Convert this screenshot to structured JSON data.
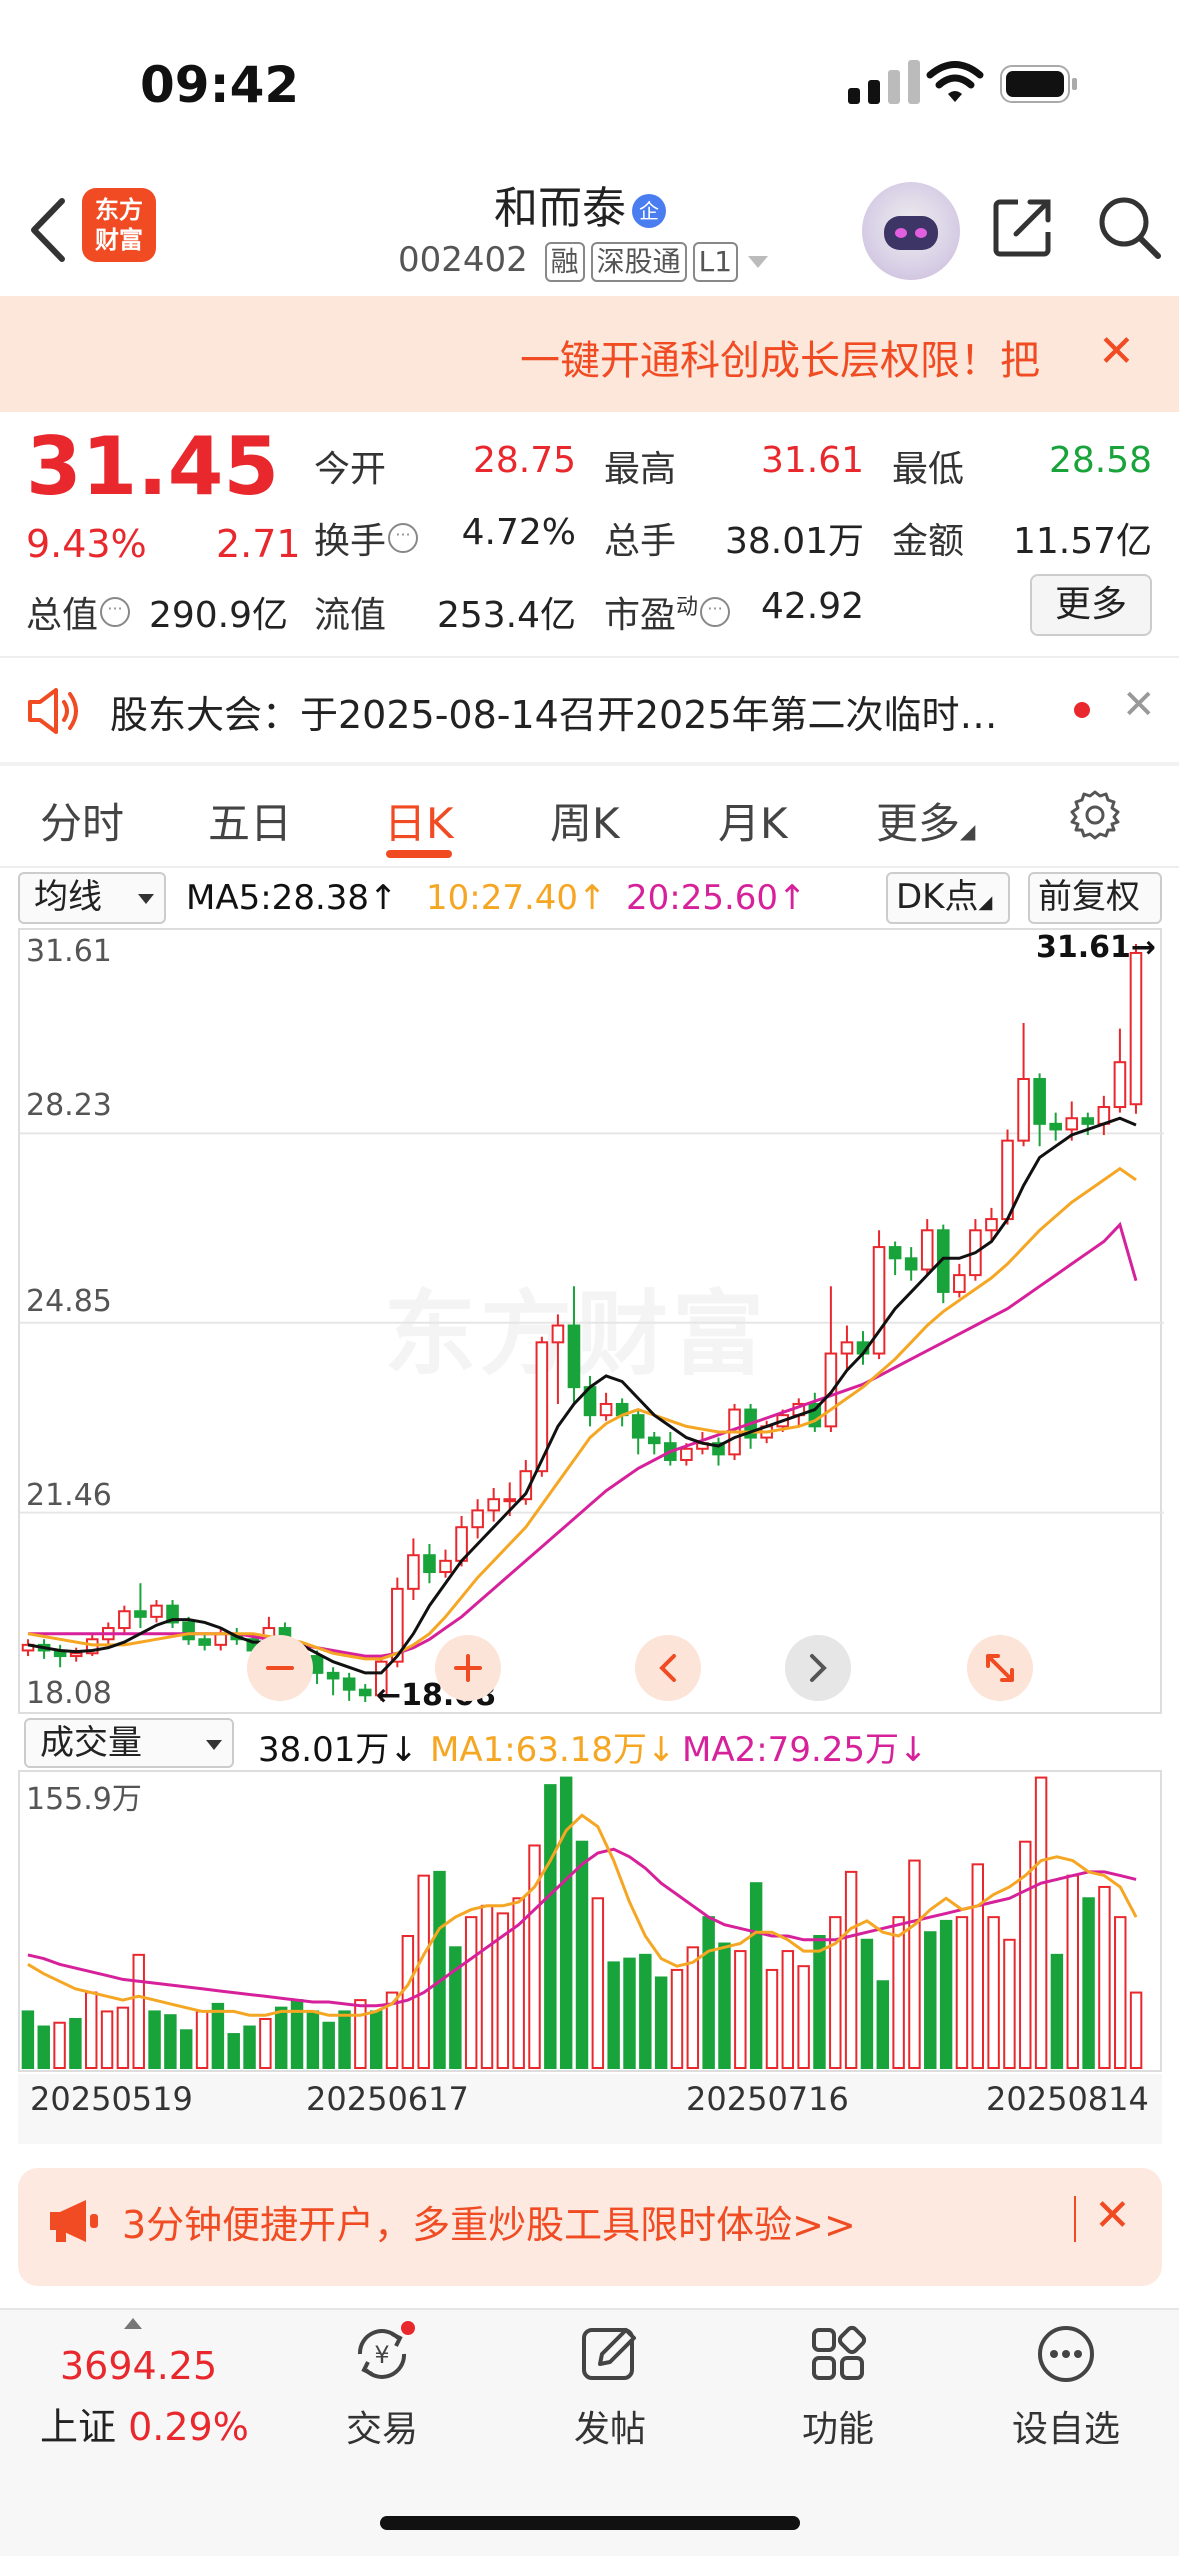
{
  "status_bar": {
    "time": "09:42"
  },
  "header": {
    "logo_text_1": "东方",
    "logo_text_2": "财富",
    "title": "和而泰",
    "badge": "企",
    "code": "002402",
    "tags": [
      "融",
      "深股通",
      "L1"
    ]
  },
  "banner": {
    "text": "一键开通科创成长层权限！把",
    "close": "✕"
  },
  "quote": {
    "price": "31.45",
    "change_pct": "9.43%",
    "change_amt": "2.71",
    "stats": [
      {
        "label": "今开",
        "value": "28.75",
        "color": "#e8282d"
      },
      {
        "label": "最高",
        "value": "31.61",
        "color": "#e8282d"
      },
      {
        "label": "最低",
        "value": "28.58",
        "color": "#19a33b"
      },
      {
        "label": "换手",
        "value": "4.72%",
        "color": "#222222"
      },
      {
        "label": "总手",
        "value": "38.01万",
        "color": "#222222"
      },
      {
        "label": "金额",
        "value": "11.57亿",
        "color": "#222222"
      },
      {
        "label": "总值",
        "value": "290.9亿",
        "color": "#222222"
      },
      {
        "label": "流值",
        "value": "253.4亿",
        "color": "#222222"
      },
      {
        "label": "市盈",
        "value": "42.92",
        "color": "#222222"
      }
    ],
    "pe_sup": "动",
    "more": "更多"
  },
  "notice": {
    "text": "股东大会：于2025-08-14召开2025年第二次临时…",
    "close": "✕"
  },
  "tabs": [
    "分时",
    "五日",
    "日K",
    "周K",
    "月K",
    "更多"
  ],
  "active_tab": "日K",
  "ma_bar": {
    "select": "均线",
    "ma5": "MA5:28.38↑",
    "ma10": "10:27.40↑",
    "ma20": "20:25.60↑",
    "dk": "DK点",
    "adjust": "前复权"
  },
  "vol_bar": {
    "select": "成交量",
    "vol": "38.01万↓",
    "ma1": "MA1:63.18万↓",
    "ma2": "MA2:79.25万↓"
  },
  "colors": {
    "up": "#e8282d",
    "down": "#19a33b",
    "ma5": "#111111",
    "ma10": "#f5a623",
    "ma20": "#d6219b",
    "brand": "#f04b23"
  },
  "watermark": "东方财富",
  "chart_data": [
    {
      "type": "candlestick",
      "title": "",
      "y_axis_labels": [
        "31.61",
        "28.23",
        "24.85",
        "21.46",
        "18.08"
      ],
      "ylim": [
        18.08,
        31.61
      ],
      "high_marker": "31.61→",
      "low_marker": "←18.08",
      "x_labels": [
        "20250519",
        "20250617",
        "20250716",
        "20250814"
      ],
      "candles": [
        [
          19.0,
          19.1,
          18.9,
          19.2
        ],
        [
          19.1,
          19.0,
          18.85,
          19.2
        ],
        [
          19.0,
          18.9,
          18.7,
          19.1
        ],
        [
          18.9,
          18.95,
          18.8,
          19.05
        ],
        [
          18.95,
          19.2,
          18.9,
          19.3
        ],
        [
          19.2,
          19.4,
          19.1,
          19.5
        ],
        [
          19.4,
          19.7,
          19.3,
          19.8
        ],
        [
          19.7,
          19.6,
          19.4,
          20.2
        ],
        [
          19.6,
          19.8,
          19.5,
          19.9
        ],
        [
          19.8,
          19.5,
          19.4,
          19.9
        ],
        [
          19.5,
          19.2,
          19.1,
          19.6
        ],
        [
          19.2,
          19.1,
          19.0,
          19.3
        ],
        [
          19.1,
          19.3,
          19.0,
          19.4
        ],
        [
          19.3,
          19.2,
          19.1,
          19.4
        ],
        [
          19.2,
          19.0,
          18.9,
          19.3
        ],
        [
          19.0,
          19.4,
          18.9,
          19.6
        ],
        [
          19.4,
          19.0,
          18.8,
          19.5
        ],
        [
          19.0,
          18.9,
          18.7,
          19.1
        ],
        [
          18.9,
          18.6,
          18.4,
          19.0
        ],
        [
          18.6,
          18.5,
          18.2,
          18.7
        ],
        [
          18.5,
          18.3,
          18.1,
          18.6
        ],
        [
          18.3,
          18.2,
          18.08,
          18.4
        ],
        [
          18.2,
          18.8,
          18.1,
          18.9
        ],
        [
          18.8,
          20.1,
          18.7,
          20.3
        ],
        [
          20.1,
          20.7,
          19.9,
          21.0
        ],
        [
          20.7,
          20.4,
          20.2,
          20.9
        ],
        [
          20.4,
          20.6,
          20.3,
          20.8
        ],
        [
          20.6,
          21.2,
          20.5,
          21.4
        ],
        [
          21.2,
          21.5,
          21.0,
          21.7
        ],
        [
          21.5,
          21.7,
          21.3,
          21.9
        ],
        [
          21.7,
          21.7,
          21.4,
          22.0
        ],
        [
          21.7,
          22.2,
          21.6,
          22.4
        ],
        [
          22.2,
          24.5,
          22.1,
          24.6
        ],
        [
          24.5,
          24.8,
          23.4,
          25.0
        ],
        [
          24.8,
          23.7,
          23.4,
          25.5
        ],
        [
          23.7,
          23.2,
          23.0,
          23.9
        ],
        [
          23.2,
          23.4,
          23.1,
          23.6
        ],
        [
          23.4,
          23.2,
          23.0,
          23.5
        ],
        [
          23.2,
          22.8,
          22.5,
          23.3
        ],
        [
          22.8,
          22.7,
          22.5,
          22.9
        ],
        [
          22.7,
          22.4,
          22.3,
          22.9
        ],
        [
          22.4,
          22.6,
          22.3,
          22.7
        ],
        [
          22.6,
          22.7,
          22.5,
          22.9
        ],
        [
          22.7,
          22.5,
          22.3,
          22.8
        ],
        [
          22.5,
          23.3,
          22.4,
          23.4
        ],
        [
          23.3,
          22.8,
          22.6,
          23.4
        ],
        [
          22.8,
          23.0,
          22.7,
          23.1
        ],
        [
          23.0,
          23.2,
          22.9,
          23.3
        ],
        [
          23.2,
          23.4,
          23.0,
          23.5
        ],
        [
          23.4,
          23.0,
          22.9,
          23.6
        ],
        [
          23.0,
          24.3,
          22.9,
          25.5
        ],
        [
          24.3,
          24.5,
          24.0,
          24.8
        ],
        [
          24.5,
          24.3,
          24.1,
          24.7
        ],
        [
          24.3,
          26.2,
          24.2,
          26.5
        ],
        [
          26.2,
          26.0,
          25.7,
          26.3
        ],
        [
          26.0,
          25.8,
          25.6,
          26.2
        ],
        [
          25.8,
          26.5,
          25.7,
          26.7
        ],
        [
          26.5,
          25.4,
          25.2,
          26.6
        ],
        [
          25.4,
          25.7,
          25.3,
          25.9
        ],
        [
          25.7,
          26.5,
          25.6,
          26.7
        ],
        [
          26.5,
          26.7,
          26.3,
          26.9
        ],
        [
          26.7,
          28.1,
          26.6,
          28.3
        ],
        [
          28.1,
          29.2,
          28.0,
          30.2
        ],
        [
          29.2,
          28.4,
          28.0,
          29.3
        ],
        [
          28.4,
          28.3,
          28.1,
          28.6
        ],
        [
          28.3,
          28.5,
          28.1,
          28.8
        ],
        [
          28.5,
          28.4,
          28.2,
          28.6
        ],
        [
          28.4,
          28.7,
          28.2,
          28.9
        ],
        [
          28.7,
          29.5,
          28.6,
          30.1
        ],
        [
          28.75,
          31.45,
          28.58,
          31.61
        ]
      ],
      "ma5": [
        19.1,
        19.05,
        19.0,
        18.98,
        19.0,
        19.05,
        19.15,
        19.3,
        19.45,
        19.55,
        19.55,
        19.5,
        19.4,
        19.25,
        19.15,
        19.15,
        19.15,
        19.1,
        18.95,
        18.8,
        18.7,
        18.6,
        18.6,
        18.9,
        19.3,
        19.8,
        20.2,
        20.6,
        20.9,
        21.2,
        21.5,
        21.8,
        22.4,
        23.0,
        23.4,
        23.7,
        23.9,
        23.8,
        23.5,
        23.2,
        23.0,
        22.8,
        22.7,
        22.65,
        22.8,
        22.9,
        23.0,
        23.1,
        23.2,
        23.3,
        23.6,
        24.0,
        24.3,
        24.7,
        25.1,
        25.4,
        25.7,
        26.0,
        26.0,
        26.1,
        26.3,
        26.7,
        27.3,
        27.8,
        28.0,
        28.2,
        28.3,
        28.4,
        28.5,
        28.38
      ],
      "ma10": [
        19.3,
        19.25,
        19.2,
        19.15,
        19.1,
        19.1,
        19.1,
        19.15,
        19.2,
        19.25,
        19.3,
        19.3,
        19.3,
        19.3,
        19.3,
        19.25,
        19.2,
        19.15,
        19.05,
        18.95,
        18.9,
        18.85,
        18.85,
        18.95,
        19.1,
        19.3,
        19.6,
        19.95,
        20.3,
        20.6,
        20.9,
        21.2,
        21.6,
        22.0,
        22.4,
        22.8,
        23.05,
        23.2,
        23.3,
        23.2,
        23.1,
        23.0,
        22.95,
        22.9,
        22.9,
        22.9,
        22.9,
        22.95,
        23.0,
        23.1,
        23.3,
        23.5,
        23.7,
        23.95,
        24.2,
        24.5,
        24.8,
        25.05,
        25.25,
        25.45,
        25.65,
        25.9,
        26.2,
        26.5,
        26.75,
        27.0,
        27.2,
        27.4,
        27.6,
        27.4
      ],
      "ma20": [
        19.3,
        19.3,
        19.3,
        19.3,
        19.3,
        19.3,
        19.3,
        19.3,
        19.3,
        19.3,
        19.3,
        19.3,
        19.3,
        19.3,
        19.25,
        19.2,
        19.15,
        19.1,
        19.05,
        19.0,
        18.95,
        18.9,
        18.9,
        18.95,
        19.05,
        19.2,
        19.4,
        19.6,
        19.85,
        20.1,
        20.35,
        20.6,
        20.85,
        21.1,
        21.35,
        21.6,
        21.85,
        22.05,
        22.25,
        22.4,
        22.55,
        22.65,
        22.75,
        22.85,
        22.95,
        23.05,
        23.15,
        23.25,
        23.35,
        23.45,
        23.55,
        23.65,
        23.75,
        23.9,
        24.05,
        24.2,
        24.35,
        24.5,
        24.65,
        24.8,
        24.95,
        25.1,
        25.3,
        25.5,
        25.7,
        25.9,
        26.1,
        26.3,
        26.6,
        25.6
      ]
    },
    {
      "type": "bar",
      "title": "",
      "y_axis_labels": [
        "155.9万"
      ],
      "ylim": [
        0,
        155.9
      ],
      "x_labels": [
        "20250519",
        "20250617",
        "20250716",
        "20250814"
      ],
      "values": [
        30,
        22,
        24,
        26,
        40,
        30,
        32,
        60,
        30,
        28,
        20,
        30,
        34,
        18,
        22,
        26,
        32,
        36,
        30,
        24,
        30,
        36,
        30,
        40,
        70,
        102,
        104,
        64,
        80,
        86,
        82,
        90,
        118,
        150,
        154,
        120,
        90,
        56,
        58,
        60,
        48,
        52,
        64,
        80,
        66,
        62,
        98,
        52,
        62,
        54,
        70,
        80,
        104,
        68,
        46,
        80,
        110,
        72,
        78,
        80,
        108,
        80,
        68,
        120,
        154,
        60,
        102,
        90,
        96,
        80,
        40
      ],
      "up": [
        0,
        0,
        1,
        0,
        1,
        1,
        1,
        1,
        0,
        0,
        0,
        1,
        0,
        0,
        0,
        1,
        0,
        0,
        0,
        0,
        0,
        1,
        0,
        1,
        1,
        1,
        0,
        0,
        1,
        1,
        1,
        1,
        1,
        0,
        0,
        0,
        1,
        0,
        0,
        0,
        0,
        1,
        1,
        0,
        0,
        1,
        0,
        1,
        1,
        1,
        0,
        1,
        1,
        0,
        0,
        1,
        1,
        0,
        0,
        1,
        1,
        1,
        1,
        1,
        1,
        0,
        1,
        0,
        1,
        1,
        1
      ],
      "ma1": [
        55,
        50,
        46,
        42,
        40,
        38,
        36,
        38,
        36,
        34,
        32,
        30,
        30,
        30,
        28,
        28,
        30,
        30,
        30,
        28,
        28,
        28,
        30,
        34,
        44,
        60,
        74,
        80,
        84,
        86,
        86,
        88,
        96,
        110,
        126,
        134,
        128,
        110,
        88,
        70,
        58,
        54,
        56,
        62,
        64,
        66,
        72,
        72,
        68,
        62,
        62,
        66,
        74,
        78,
        72,
        70,
        76,
        84,
        90,
        84,
        86,
        92,
        96,
        102,
        110,
        112,
        110,
        104,
        102,
        96,
        80
      ],
      "ma2": [
        60,
        58,
        55,
        53,
        51,
        49,
        47,
        46,
        45,
        44,
        43,
        42,
        41,
        40,
        39,
        38,
        37,
        36,
        35,
        35,
        34,
        33,
        33,
        34,
        36,
        40,
        46,
        52,
        58,
        64,
        70,
        76,
        84,
        92,
        100,
        108,
        114,
        116,
        112,
        106,
        98,
        92,
        86,
        80,
        76,
        74,
        72,
        70,
        70,
        68,
        68,
        68,
        70,
        72,
        74,
        76,
        78,
        80,
        82,
        84,
        86,
        88,
        90,
        94,
        98,
        100,
        102,
        104,
        104,
        102,
        100
      ]
    }
  ],
  "promo": {
    "text": "3分钟便捷开户，多重炒股工具限时体验>>",
    "close": "✕"
  },
  "bottom_nav": {
    "index_value": "3694.25",
    "index_name": "上证",
    "index_pct": "0.29%",
    "items": [
      {
        "label": "交易",
        "icon": "trade-icon"
      },
      {
        "label": "发帖",
        "icon": "post-icon"
      },
      {
        "label": "功能",
        "icon": "apps-icon"
      },
      {
        "label": "设自选",
        "icon": "more-icon"
      }
    ]
  }
}
